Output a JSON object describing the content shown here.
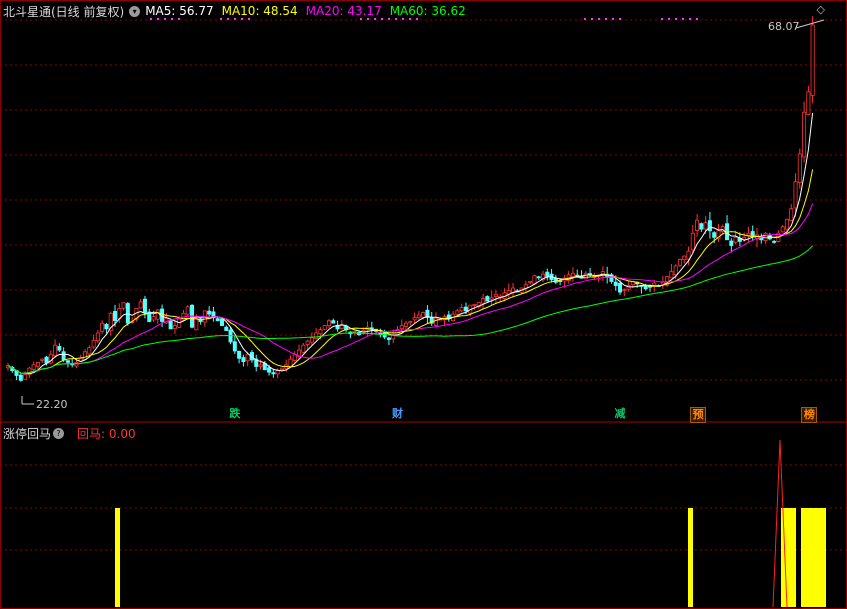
{
  "header": {
    "title": "北斗星通(日线 前复权)",
    "ma": [
      {
        "label": "MA5: 56.77",
        "color": "#ffffff"
      },
      {
        "label": "MA10: 48.54",
        "color": "#ffff00"
      },
      {
        "label": "MA20: 43.17",
        "color": "#ff00ff"
      },
      {
        "label": "MA60: 36.62",
        "color": "#00ff00"
      }
    ]
  },
  "price": {
    "high_label": "68.07",
    "low_label": "22.20",
    "high": 68.07,
    "low": 22.2
  },
  "markers": [
    {
      "text": "跌",
      "color": "#00cc66",
      "bar": 53
    },
    {
      "text": "财",
      "color": "#4a9cff",
      "bar": 91
    },
    {
      "text": "减",
      "color": "#00cc66",
      "bar": 143
    },
    {
      "text": "预",
      "color": "#ff8a00",
      "bar": 161
    },
    {
      "text": "榜",
      "color": "#ff8a00",
      "bar": 187
    }
  ],
  "sub": {
    "title": "涨停回马",
    "indicator_label": "回马: 0.00",
    "indicator_color": "#ff3333",
    "bar_color": "#ffff00"
  },
  "colors": {
    "up": "#ff3232",
    "down": "#54ffff",
    "grid": "#8a0000"
  },
  "chart_data": {
    "type": "candlestick",
    "series_note": "",
    "close": [
      26.4,
      25.8,
      25.2,
      24.6,
      25.3,
      26.1,
      26.5,
      26.8,
      27.2,
      26.7,
      27.8,
      28.9,
      28.3,
      27.1,
      26.8,
      26.5,
      26.8,
      27.3,
      28.1,
      28.6,
      29.5,
      30.4,
      31.6,
      30.9,
      32.8,
      31.9,
      33.4,
      34.1,
      31.6,
      31.8,
      33.4,
      34.2,
      32.9,
      31.8,
      32.4,
      33.2,
      31.8,
      32.2,
      30.9,
      31.3,
      32.1,
      32.8,
      33.6,
      31.1,
      32.2,
      31.8,
      33.1,
      32.7,
      32.3,
      31.9,
      31.3,
      30.7,
      29.3,
      28.2,
      27.3,
      26.9,
      27.8,
      27.1,
      26.3,
      26.5,
      25.9,
      25.6,
      25.4,
      25.8,
      26.1,
      26.5,
      27.2,
      27.8,
      28.3,
      28.9,
      29.4,
      29.8,
      30.4,
      30.8,
      31.3,
      31.9,
      31.6,
      30.9,
      31.3,
      30.8,
      30.3,
      30.6,
      30.2,
      30.7,
      31.1,
      30.9,
      30.6,
      30.3,
      29.9,
      29.6,
      30.2,
      30.8,
      31.3,
      31.6,
      31.8,
      32.3,
      32.6,
      32.9,
      32.3,
      31.6,
      32.2,
      32.1,
      32.4,
      32.2,
      32.7,
      33.1,
      33.5,
      33.1,
      33.8,
      33.9,
      34.1,
      34.6,
      34.3,
      34.7,
      35.1,
      34.9,
      35.3,
      35.6,
      35.9,
      35.5,
      35.9,
      36.3,
      36.7,
      37.4,
      37.2,
      37.6,
      37.3,
      36.9,
      36.6,
      36.8,
      37.1,
      37.5,
      37.7,
      37.4,
      37.1,
      37.7,
      37.6,
      37.3,
      37.5,
      37.9,
      37.2,
      36.7,
      36.2,
      35.4,
      35.7,
      36.2,
      36.7,
      36.4,
      36.1,
      35.8,
      36.1,
      36.5,
      36.2,
      36.6,
      37.3,
      37.9,
      38.6,
      39.4,
      39.8,
      40.4,
      42.6,
      44.2,
      43.1,
      43.9,
      42.9,
      42.1,
      42.9,
      43.4,
      41.8,
      41.1,
      42.1,
      41.6,
      42.1,
      42.6,
      42.3,
      42.4,
      41.8,
      42.6,
      41.9,
      41.6,
      42.6,
      43.4,
      44.3,
      45.6,
      48.9,
      52.3,
      57.4,
      59.9,
      68.07
    ],
    "ma_lines": [
      "MA5",
      "MA10",
      "MA20",
      "MA60"
    ]
  }
}
